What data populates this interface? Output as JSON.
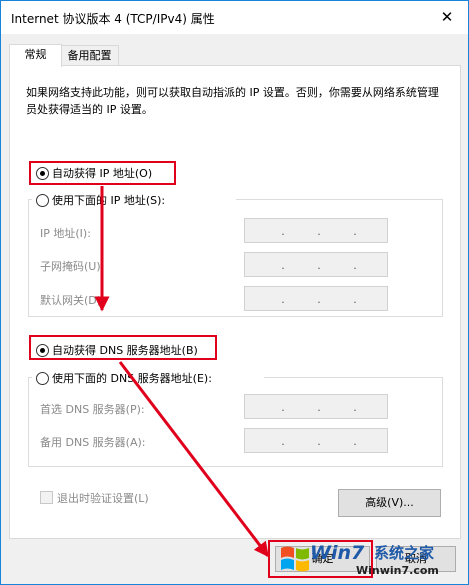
{
  "window": {
    "title": "Internet 协议版本 4 (TCP/IPv4) 属性",
    "close_glyph": "✕"
  },
  "tabs": [
    {
      "label": "常规"
    },
    {
      "label": "备用配置"
    }
  ],
  "description": "如果网络支持此功能，则可以获取自动指派的 IP 设置。否则，你需要从网络系统管理员处获得适当的 IP 设置。",
  "ip_section": {
    "auto_label": "自动获得 IP 地址(O)",
    "manual_label": "使用下面的 IP 地址(S):",
    "fields": [
      {
        "label": "IP 地址(I):"
      },
      {
        "label": "子网掩码(U):"
      },
      {
        "label": "默认网关(D):"
      }
    ]
  },
  "dns_section": {
    "auto_label": "自动获得 DNS 服务器地址(B)",
    "manual_label": "使用下面的 DNS 服务器地址(E):",
    "fields": [
      {
        "label": "首选 DNS 服务器(P):"
      },
      {
        "label": "备用 DNS 服务器(A):"
      }
    ]
  },
  "ip_separator": ".",
  "validate_on_exit": {
    "label": "退出时验证设置(L)",
    "checked": false
  },
  "buttons": {
    "advanced": "高级(V)...",
    "ok": "确定",
    "cancel": "取消"
  },
  "watermark": {
    "brand": "Win7",
    "site_name": "系统之家",
    "url": "Winwin7.com"
  },
  "colors": {
    "annotation_red": "#e0001b",
    "accent_blue": "#1883d7"
  }
}
